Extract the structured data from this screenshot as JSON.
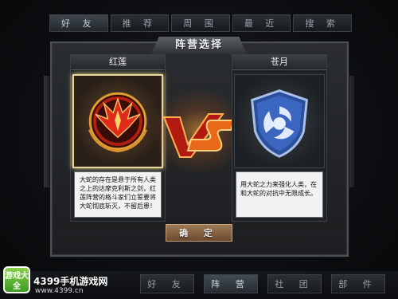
{
  "top_tabs": [
    "好 友",
    "推 荐",
    "周 围",
    "最 近",
    "搜 索"
  ],
  "dialog": {
    "title": "阵营选择",
    "confirm_label": "确 定"
  },
  "factions": [
    {
      "name": "红莲",
      "description": "大蛇的存在是悬于所有人类之上的达摩克利斯之剑，红莲阵营的格斗家们立誓要将大蛇彻底斩灭，不留后患！",
      "emblem_color": "#d0201a",
      "selected": true
    },
    {
      "name": "苍月",
      "description": "用大蛇之力来强化人类，在和大蛇的对抗中无限成长。",
      "emblem_color": "#3a5fb0",
      "selected": false
    }
  ],
  "bottom_tabs": [
    "好 友",
    "阵 营",
    "社 团",
    "部 件"
  ],
  "active_bottom_tab": "阵 营",
  "watermark": {
    "logo_text": "游戏大全",
    "site_name": "4399手机游戏网",
    "url": "www.4399.cn"
  },
  "colors": {
    "red_faction": "#d0201a",
    "blue_faction": "#3a5fb0",
    "confirm_button": "#8a6240",
    "vs_orange": "#f07a1a"
  }
}
